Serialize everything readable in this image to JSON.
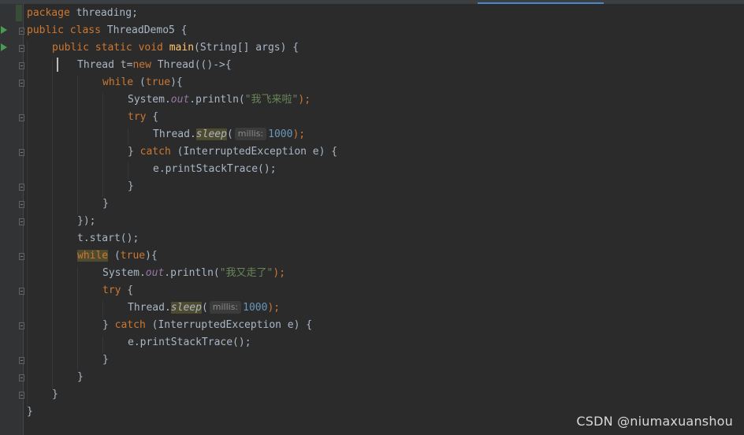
{
  "code": {
    "l1": {
      "kw": "package",
      "rest": " threading;"
    },
    "l2": {
      "kw": "public class",
      "name": " ThreadDemo5 {"
    },
    "l3": {
      "kw": "public static void",
      "method": "main",
      "rest": "(String[] args) {"
    },
    "l4": {
      "type": "Thread t=",
      "kw": "new",
      "rest": " Thread(()->{"
    },
    "l5": {
      "kw": "while",
      "open": " (",
      "kw2": "true",
      "close": "){"
    },
    "l6": {
      "pre": "System.",
      "field": "out",
      "mid": ".println(",
      "str": "\"我飞来啦\"",
      "end": ");"
    },
    "l7": {
      "kw": "try",
      "rest": " {"
    },
    "l8": {
      "pre": "Thread.",
      "method": "sleep",
      "open": "(",
      "hint": "millis:",
      "num": "1000",
      "end": ");"
    },
    "l9": {
      "pre": "} ",
      "kw": "catch",
      "rest": " (InterruptedException e) {"
    },
    "l10": {
      "text": "e.printStackTrace();"
    },
    "l11": {
      "text": "}"
    },
    "l12": {
      "text": "}"
    },
    "l13": {
      "text": "});"
    },
    "l14": {
      "text": "t.start();"
    },
    "l15": {
      "kw": "while",
      "open": " (",
      "kw2": "true",
      "close": "){"
    },
    "l16": {
      "pre": "System.",
      "field": "out",
      "mid": ".println(",
      "str": "\"我又走了\"",
      "end": ");"
    },
    "l17": {
      "kw": "try",
      "rest": " {"
    },
    "l18": {
      "pre": "Thread.",
      "method": "sleep",
      "open": "(",
      "hint": "millis:",
      "num": "1000",
      "end": ");"
    },
    "l19": {
      "pre": "} ",
      "kw": "catch",
      "rest": " (InterruptedException e) {"
    },
    "l20": {
      "text": "e.printStackTrace();"
    },
    "l21": {
      "text": "}"
    },
    "l22": {
      "text": "}"
    },
    "l23": {
      "text": "}"
    },
    "l24": {
      "text": "}"
    }
  },
  "icons": {
    "run": "run-triangle-icon",
    "fold": "fold-marker-icon"
  },
  "colors": {
    "background": "#2b2b2b",
    "keyword": "#cc7832",
    "string": "#6a8759",
    "number": "#6897bb",
    "method": "#ffc66d",
    "field": "#9876aa"
  },
  "watermark": "CSDN @niumaxuanshou"
}
